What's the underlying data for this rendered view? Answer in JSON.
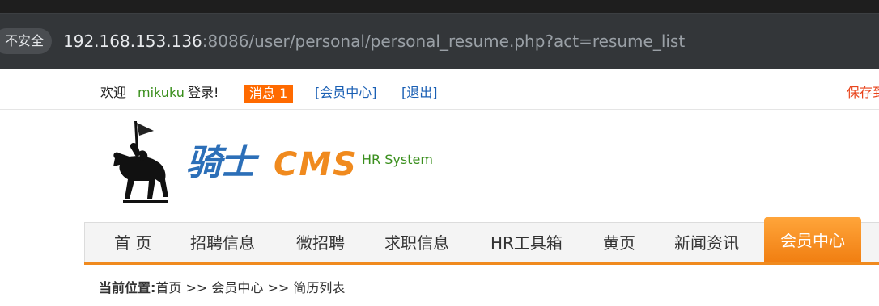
{
  "browser": {
    "security_label": "不安全",
    "url_host": "192.168.153.136",
    "url_rest": ":8086/user/personal/personal_resume.php?act=resume_list"
  },
  "topbar": {
    "welcome": "欢迎",
    "username": "mikuku",
    "login_text": "登录!",
    "messages_label": "消息 1",
    "member_center_link": "[会员中心]",
    "logout_link": "[退出]",
    "save_link": "保存到"
  },
  "logo": {
    "brand_cn": "骑士",
    "brand_en": "CMS",
    "tagline": "HR System",
    "colors": {
      "blue": "#2c6fb8",
      "orange": "#f08a1e",
      "green": "#3a8f1d"
    }
  },
  "nav": {
    "items": [
      {
        "label": "首 页"
      },
      {
        "label": "招聘信息"
      },
      {
        "label": "微招聘"
      },
      {
        "label": "求职信息"
      },
      {
        "label": "HR工具箱"
      },
      {
        "label": "黄页"
      },
      {
        "label": "新闻资讯"
      }
    ],
    "active": {
      "label": "会员中心"
    }
  },
  "breadcrumb": {
    "prefix": "当前位置:",
    "path": "首页 >> 会员中心 >> 简历列表"
  }
}
